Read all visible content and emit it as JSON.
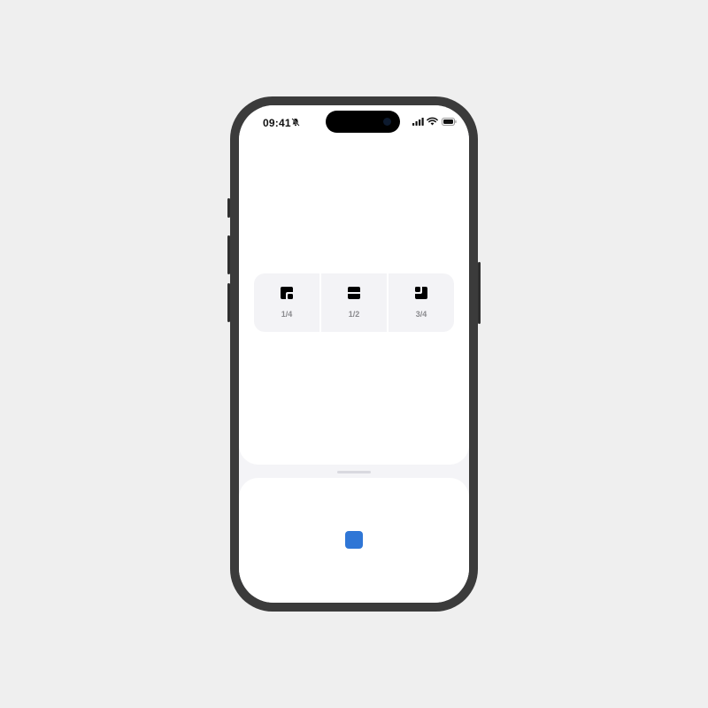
{
  "status_bar": {
    "time": "09:41",
    "icons": [
      "bell-slash-icon",
      "cellular-signal-icon",
      "wifi-icon",
      "battery-icon"
    ]
  },
  "detent_options": [
    {
      "label": "1/4",
      "icon": "quarter-detent-icon"
    },
    {
      "label": "1/2",
      "icon": "half-detent-icon"
    },
    {
      "label": "3/4",
      "icon": "three-quarter-detent-icon"
    }
  ],
  "bottom_sheet": {
    "content_icon": "square",
    "content_color": "#2f76d6"
  },
  "colors": {
    "accent": "#2f76d6",
    "background": "#efefef",
    "option_background": "#f3f3f6",
    "option_label": "#8a8a8e"
  }
}
